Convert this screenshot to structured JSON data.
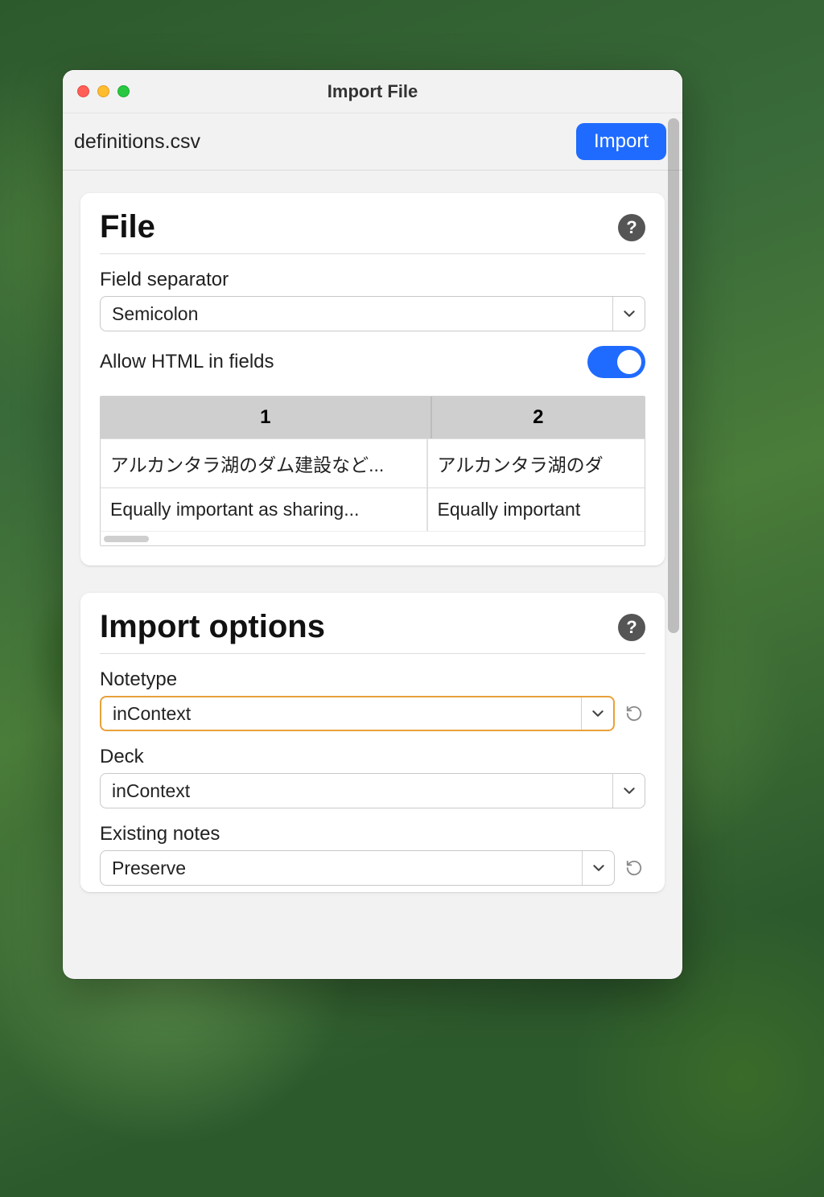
{
  "window": {
    "title": "Import File"
  },
  "toolbar": {
    "filename": "definitions.csv",
    "import_label": "Import"
  },
  "file_section": {
    "title": "File",
    "field_separator_label": "Field separator",
    "field_separator_value": "Semicolon",
    "allow_html_label": "Allow HTML in fields",
    "allow_html_enabled": true,
    "preview": {
      "headers": [
        "1",
        "2"
      ],
      "rows": [
        {
          "c1": "アルカンタラ湖のダム建設など...",
          "c2": "アルカンタラ湖のダ"
        },
        {
          "c1": "Equally important as sharing...",
          "c2": "Equally important"
        }
      ]
    }
  },
  "import_options": {
    "title": "Import options",
    "notetype_label": "Notetype",
    "notetype_value": "inContext",
    "deck_label": "Deck",
    "deck_value": "inContext",
    "existing_notes_label": "Existing notes",
    "existing_notes_value": "Preserve"
  }
}
